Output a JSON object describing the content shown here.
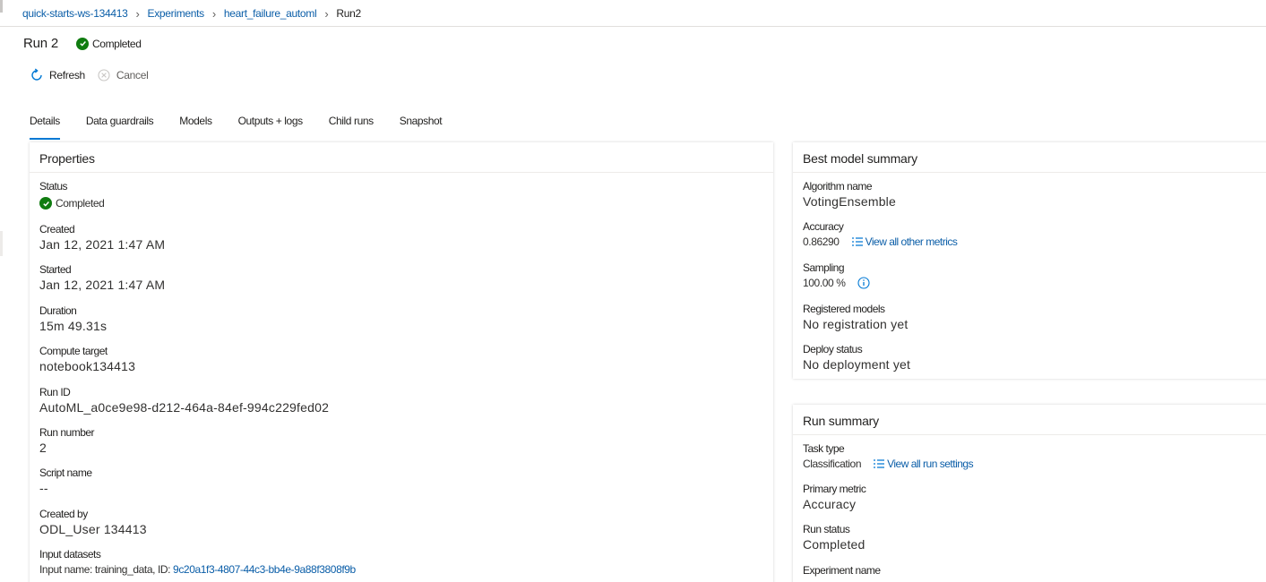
{
  "breadcrumb": {
    "workspace": "quick-starts-ws-134413",
    "experiments": "Experiments",
    "experiment": "heart_failure_automl",
    "run": "Run2"
  },
  "header": {
    "title": "Run 2",
    "status": "Completed"
  },
  "toolbar": {
    "refresh": "Refresh",
    "cancel": "Cancel"
  },
  "tabs": [
    "Details",
    "Data guardrails",
    "Models",
    "Outputs + logs",
    "Child runs",
    "Snapshot"
  ],
  "properties": {
    "title": "Properties",
    "status_label": "Status",
    "status_value": "Completed",
    "created_label": "Created",
    "created_value": "Jan 12, 2021 1:47 AM",
    "started_label": "Started",
    "started_value": "Jan 12, 2021 1:47 AM",
    "duration_label": "Duration",
    "duration_value": "15m 49.31s",
    "compute_label": "Compute target",
    "compute_value": "notebook134413",
    "runid_label": "Run ID",
    "runid_value": "AutoML_a0ce9e98-d212-464a-84ef-994c229fed02",
    "runnumber_label": "Run number",
    "runnumber_value": "2",
    "script_label": "Script name",
    "script_value": "--",
    "createdby_label": "Created by",
    "createdby_value": "ODL_User 134413",
    "datasets_label": "Input datasets",
    "datasets_prefix": "Input name: training_data, ID: ",
    "datasets_id": "9c20a1f3-4807-44c3-bb4e-9a88f3808f9b"
  },
  "best_model": {
    "title": "Best model summary",
    "algorithm_label": "Algorithm name",
    "algorithm_value": "VotingEnsemble",
    "accuracy_label": "Accuracy",
    "accuracy_value": "0.86290",
    "metrics_link": "View all other metrics",
    "sampling_label": "Sampling",
    "sampling_value": "100.00 %",
    "registered_label": "Registered models",
    "registered_value": "No registration yet",
    "deploy_label": "Deploy status",
    "deploy_value": "No deployment yet"
  },
  "run_summary": {
    "title": "Run summary",
    "task_label": "Task type",
    "task_value": "Classification",
    "settings_link": "View all run settings",
    "metric_label": "Primary metric",
    "metric_value": "Accuracy",
    "runstatus_label": "Run status",
    "runstatus_value": "Completed",
    "experiment_label": "Experiment name"
  },
  "colors": {
    "link": "#0b5ea8",
    "accent": "#0078d4",
    "success": "#107c10"
  }
}
